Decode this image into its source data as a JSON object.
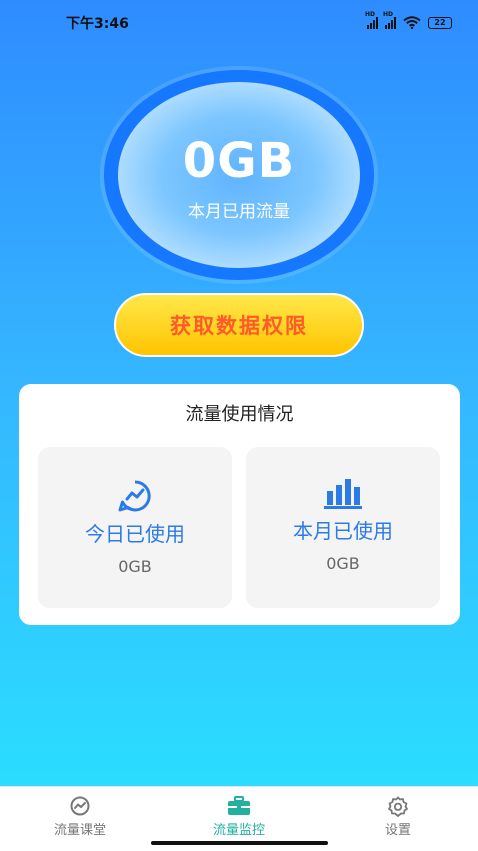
{
  "status_bar": {
    "time": "下午3:46",
    "signal_label": "HD",
    "battery": "22"
  },
  "usage_gauge": {
    "value": "0GB",
    "caption": "本月已用流量"
  },
  "permission_button": {
    "label": "获取数据权限"
  },
  "usage_card": {
    "title": "流量使用情况",
    "today": {
      "label": "今日已使用",
      "value": "0GB",
      "icon": "trend-circle-icon"
    },
    "month": {
      "label": "本月已使用",
      "value": "0GB",
      "icon": "bar-chart-icon"
    }
  },
  "tab_bar": {
    "active_index": 1,
    "tabs": [
      {
        "label": "流量课堂",
        "icon": "trend-circle-icon"
      },
      {
        "label": "流量监控",
        "icon": "briefcase-icon"
      },
      {
        "label": "设置",
        "icon": "gear-icon"
      }
    ]
  },
  "colors": {
    "accent_blue": "#2c7be5",
    "active_tab": "#23b0a0",
    "cta_text": "#ff5a2a",
    "cta_fill": "#ffc400"
  }
}
